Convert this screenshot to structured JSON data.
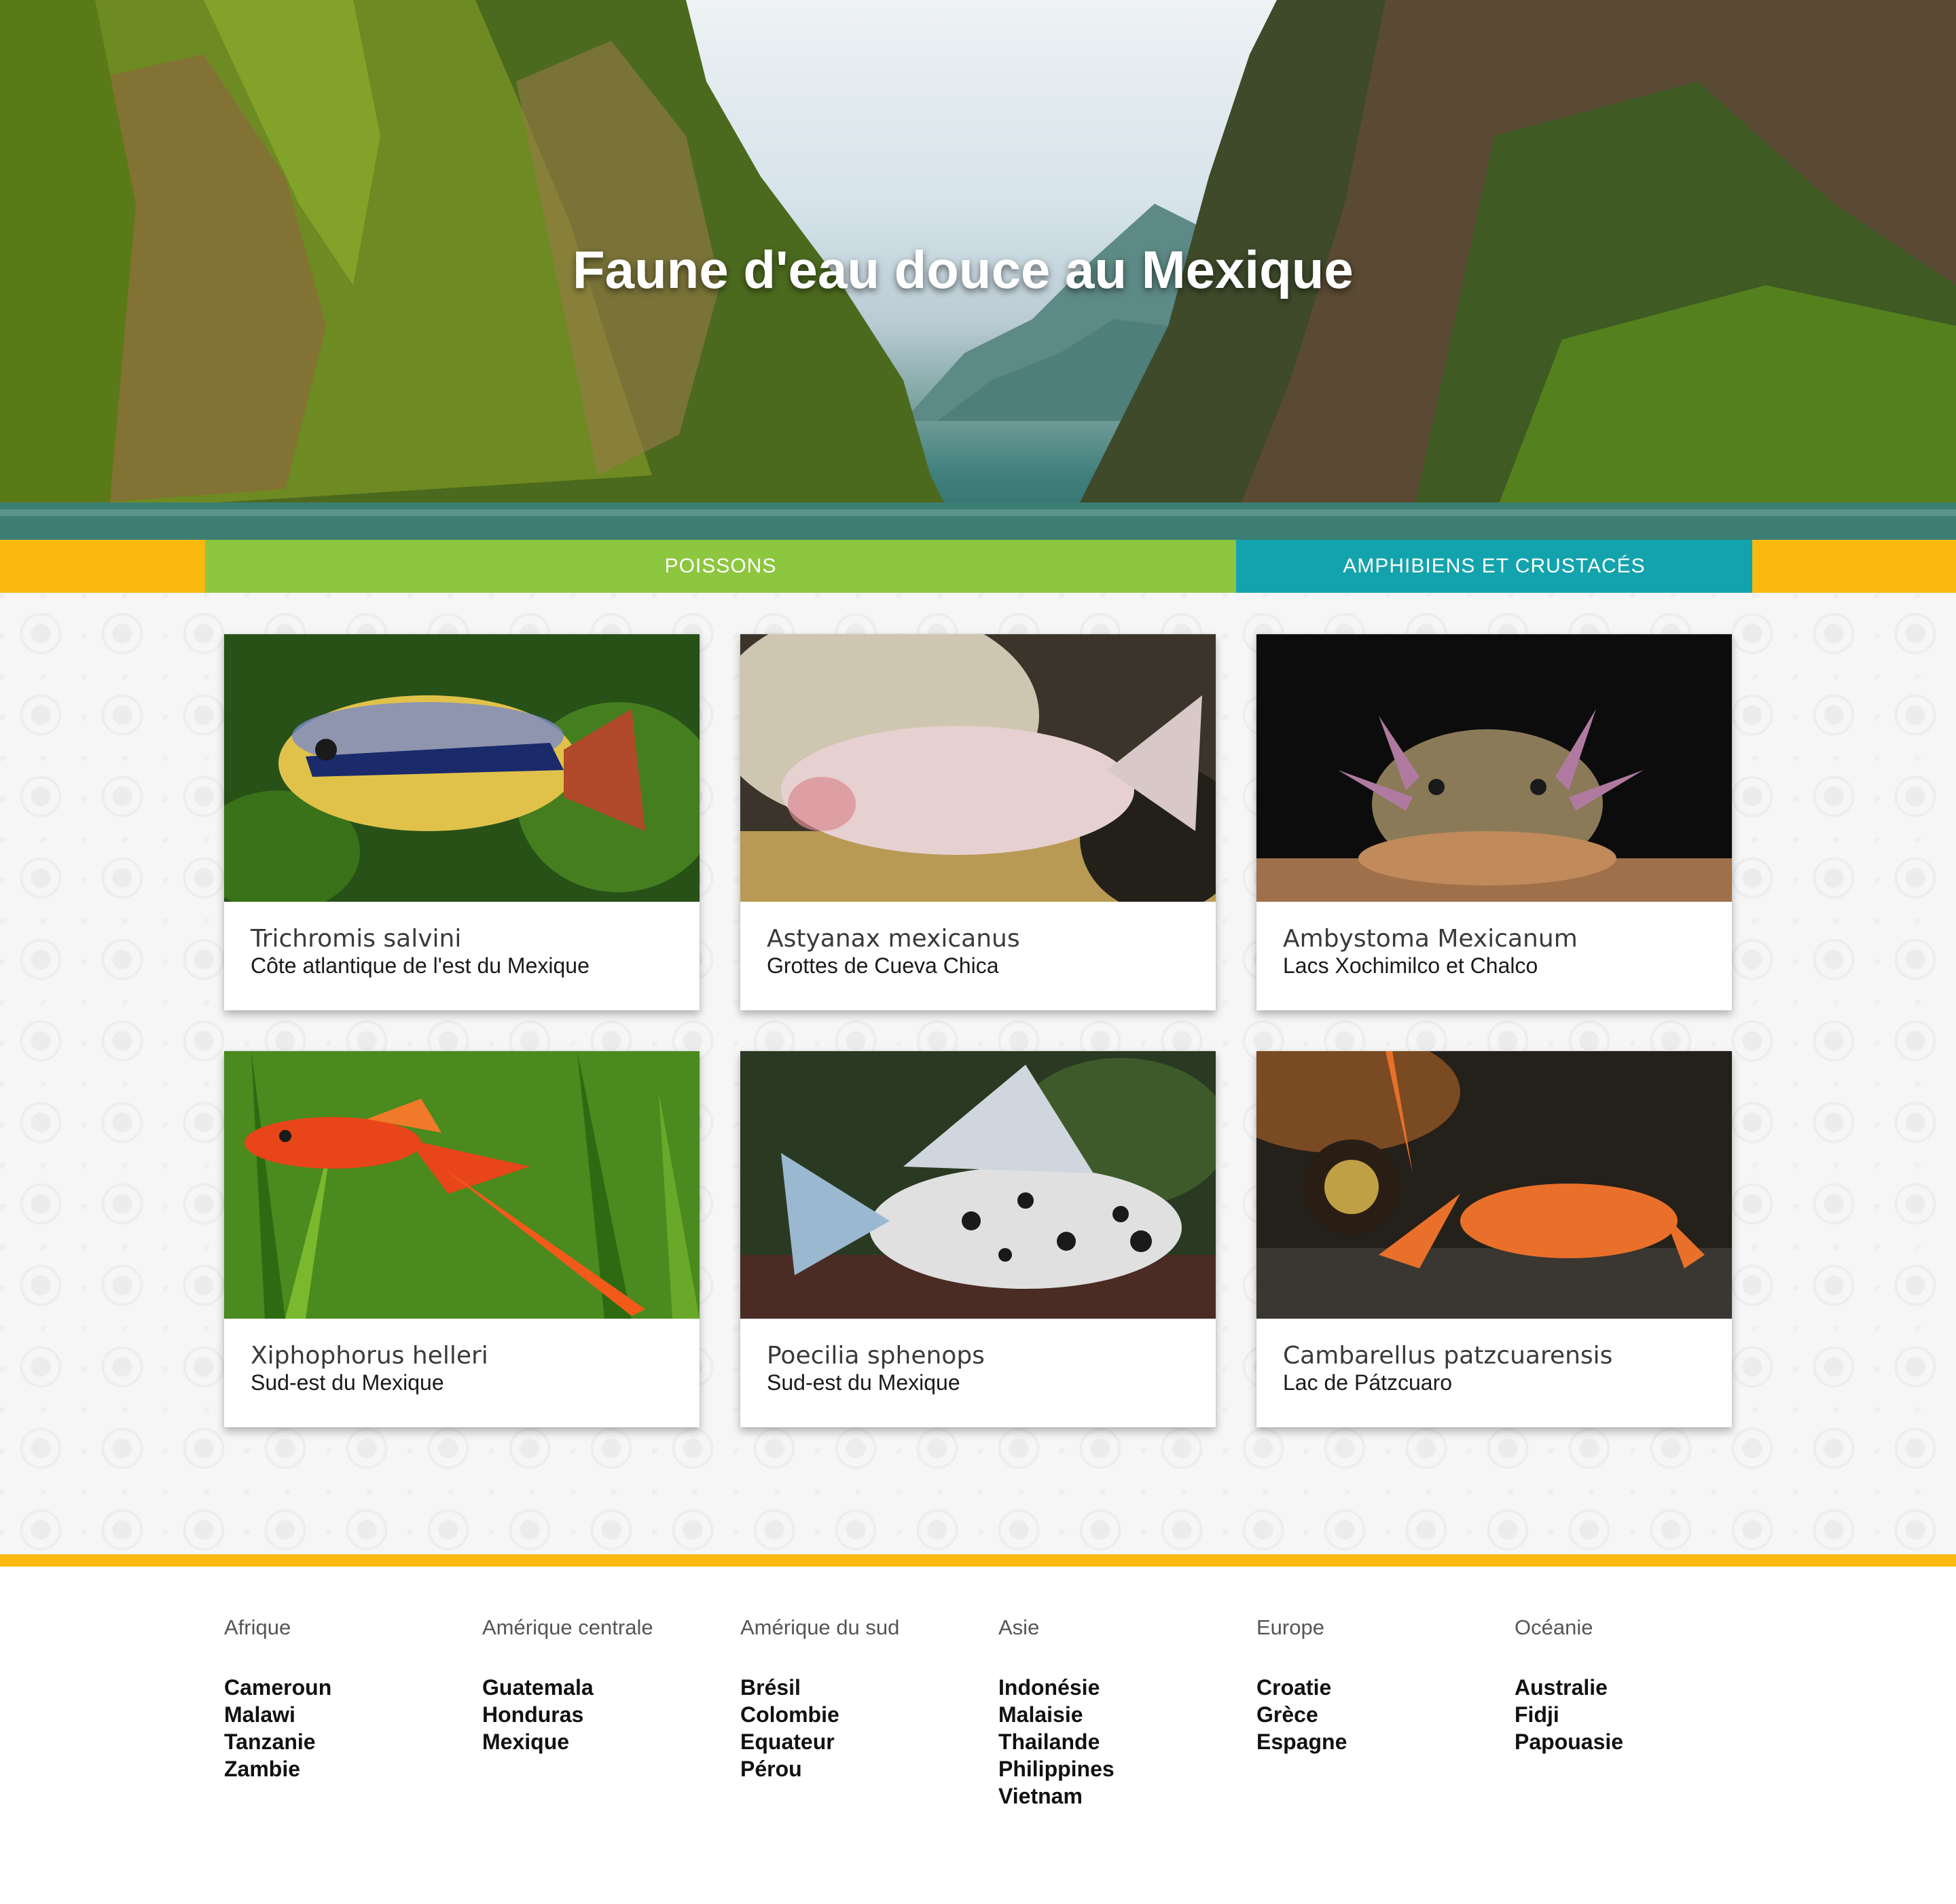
{
  "hero": {
    "title": "Faune d'eau douce au Mexique"
  },
  "tabs": [
    {
      "label": "POISSONS",
      "color": "#8dc63f"
    },
    {
      "label": "AMPHIBIENS ET CRUSTACÉS",
      "color": "#13a3ad"
    }
  ],
  "colors": {
    "accent_yellow": "#fbb80f",
    "green": "#8dc63f",
    "teal": "#13a3ad"
  },
  "cards": [
    {
      "name": "Trichromis salvini",
      "region": "Côte atlantique de l'est du Mexique",
      "image": "cichlid-fish-photo"
    },
    {
      "name": "Astyanax mexicanus",
      "region": "Grottes de Cueva Chica",
      "image": "blind-cave-fish-photo"
    },
    {
      "name": "Ambystoma Mexicanum",
      "region": "Lacs Xochimilco et Chalco",
      "image": "axolotl-photo"
    },
    {
      "name": "Xiphophorus helleri",
      "region": "Sud-est du Mexique",
      "image": "swordtail-fish-photo"
    },
    {
      "name": "Poecilia sphenops",
      "region": "Sud-est du Mexique",
      "image": "molly-fish-photo"
    },
    {
      "name": "Cambarellus patzcuarensis",
      "region": "Lac de Pátzcuaro",
      "image": "dwarf-crayfish-photo"
    }
  ],
  "footer": {
    "columns": [
      {
        "heading": "Afrique",
        "items": [
          "Cameroun",
          "Malawi",
          "Tanzanie",
          "Zambie"
        ]
      },
      {
        "heading": "Amérique centrale",
        "items": [
          "Guatemala",
          "Honduras",
          "Mexique"
        ]
      },
      {
        "heading": "Amérique du sud",
        "items": [
          "Brésil",
          "Colombie",
          "Equateur",
          "Pérou"
        ]
      },
      {
        "heading": "Asie",
        "items": [
          "Indonésie",
          "Malaisie",
          "Thailande",
          "Philippines",
          "Vietnam"
        ]
      },
      {
        "heading": "Europe",
        "items": [
          "Croatie",
          "Grèce",
          "Espagne"
        ]
      },
      {
        "heading": "Océanie",
        "items": [
          "Australie",
          "Fidji",
          "Papouasie"
        ]
      }
    ]
  }
}
